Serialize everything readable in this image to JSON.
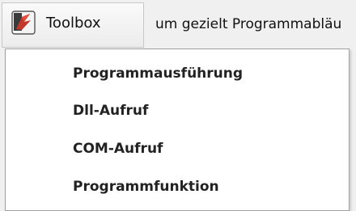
{
  "toolbar": {
    "toolbox_label": "Toolbox",
    "hint_text": "um gezielt Programmabläu"
  },
  "menu": {
    "items": [
      {
        "label": "Programmausführung"
      },
      {
        "label": "Dll-Aufruf"
      },
      {
        "label": "COM-Aufruf"
      },
      {
        "label": "Programmfunktion"
      }
    ]
  },
  "icons": {
    "toolbox": "toolbox-icon"
  },
  "colors": {
    "accent_red": "#c0392b",
    "icon_dark": "#3b3b3b"
  }
}
